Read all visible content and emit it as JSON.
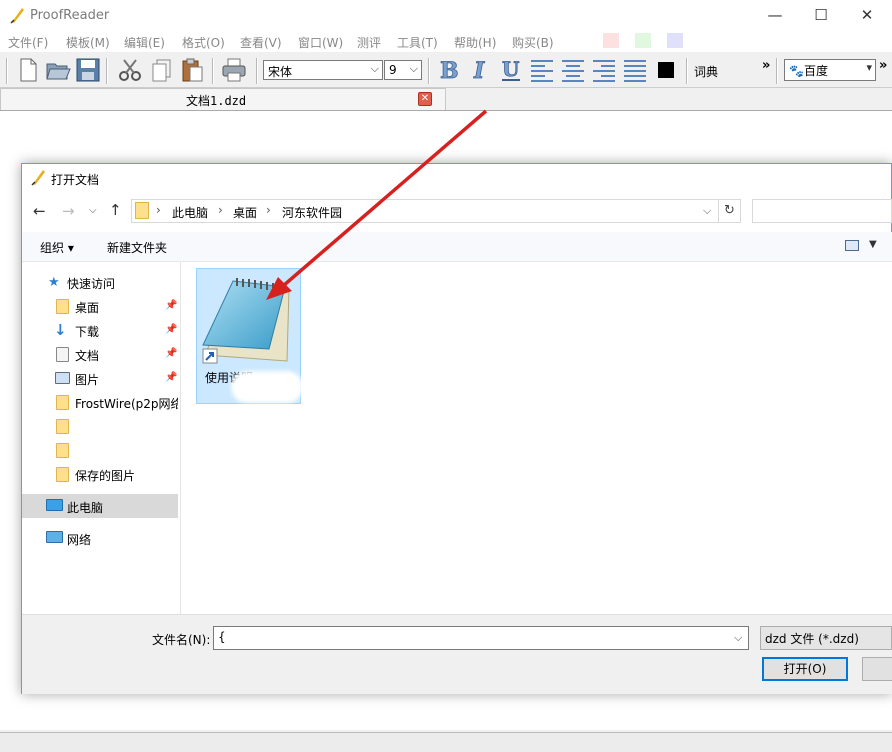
{
  "app": {
    "title": "ProofReader"
  },
  "window_controls": {
    "minimize": "—",
    "maximize": "☐",
    "close": "✕"
  },
  "menu": [
    {
      "label": "文件(F)"
    },
    {
      "label": "模板(M)"
    },
    {
      "label": "编辑(E)"
    },
    {
      "label": "格式(O)"
    },
    {
      "label": "查看(V)"
    },
    {
      "label": "窗口(W)"
    },
    {
      "label": "测评"
    },
    {
      "label": "工具(T)"
    },
    {
      "label": "帮助(H)"
    },
    {
      "label": "购买(B)"
    }
  ],
  "menu_colors": [
    "#fde0e0",
    "#e0f7e0",
    "#e0e0fa"
  ],
  "toolbar": {
    "font_name": "宋体",
    "font_size": "9",
    "dict_label": "词典",
    "more_glyph": "»",
    "search_engine": "百度",
    "text_color": "#000000"
  },
  "tab": {
    "label": "文档1.dzd",
    "close_glyph": "✕"
  },
  "dialog": {
    "title": "打开文档",
    "breadcrumb": [
      "此电脑",
      "桌面",
      "河东软件园"
    ],
    "breadcrumb_sep": "›",
    "organize": "组织 ▾",
    "new_folder": "新建文件夹",
    "nav": {
      "quick_access": "快速访问",
      "items": [
        {
          "label": "桌面",
          "icon": "folder-icon",
          "pinned": true
        },
        {
          "label": "下载",
          "icon": "download-icon",
          "pinned": true
        },
        {
          "label": "文档",
          "icon": "document-icon",
          "pinned": true
        },
        {
          "label": "图片",
          "icon": "picture-icon",
          "pinned": true
        },
        {
          "label": "FrostWire(p2p网络",
          "icon": "folder-icon",
          "pinned": false
        },
        {
          "label": "",
          "icon": "folder-icon",
          "pinned": false
        },
        {
          "label": "",
          "icon": "folder-icon",
          "pinned": false
        },
        {
          "label": "保存的图片",
          "icon": "folder-icon",
          "pinned": false
        }
      ],
      "this_pc": "此电脑",
      "network": "网络"
    },
    "file": {
      "name": "使用说明"
    },
    "filename_label": "文件名(N):",
    "filename_value": "{",
    "filetype": "dzd 文件 (*.dzd)",
    "open_button": "打开(O)"
  }
}
